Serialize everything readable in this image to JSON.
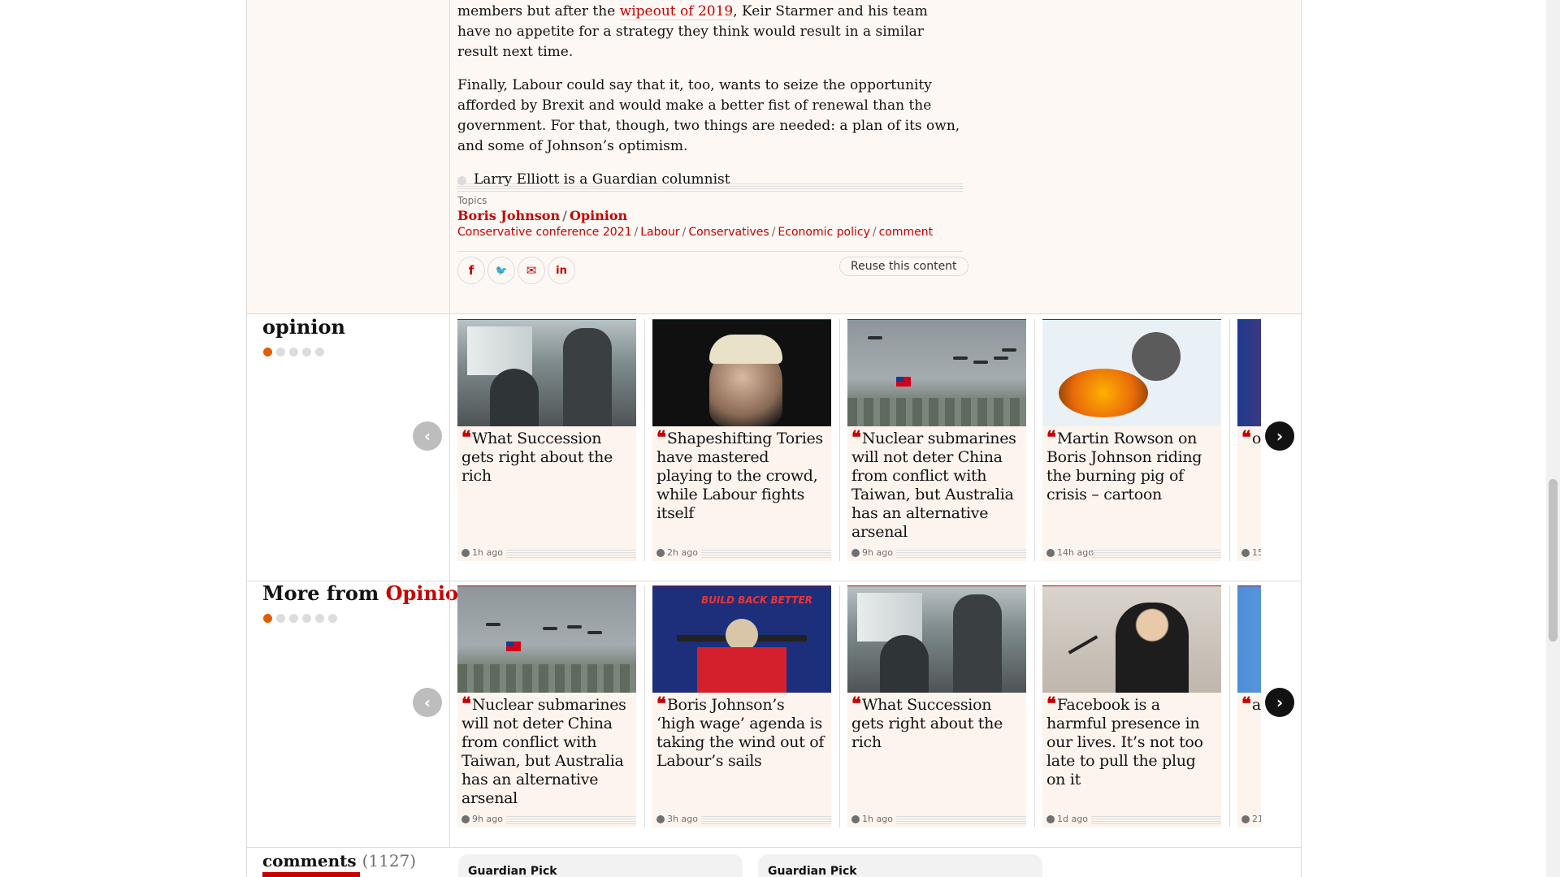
{
  "article": {
    "para1_before_link": "members but after the ",
    "para1_link": "wipeout of 2019",
    "para1_after_link": ", Keir Starmer and his team have no appetite for a strategy they think would result in a similar result next time.",
    "para2": "Finally, Labour could say that it, too, wants to seize the opportunity afforded by Brexit and would make a better fist of renewal than the government. For that, though, two things are needed: a plan of its own, and some of Johnson’s optimism.",
    "byline": "Larry Elliott is a Guardian columnist"
  },
  "topics": {
    "label": "Topics",
    "main": [
      "Boris Johnson",
      "Opinion"
    ],
    "sub": [
      "Conservative conference 2021",
      "Labour",
      "Conservatives",
      "Economic policy",
      "comment"
    ]
  },
  "share": {
    "facebook_glyph": "f",
    "twitter_glyph": "🐦",
    "email_glyph": "✉",
    "linkedin_glyph": "in",
    "reuse_label": "Reuse this content"
  },
  "opinion_section": {
    "title": "opinion",
    "cards": [
      {
        "headline": "What Succession gets right about the rich",
        "age": "1h ago",
        "image": "office-scene"
      },
      {
        "headline": "Shapeshifting Tories have mastered playing to the crowd, while Labour fights itself",
        "age": "2h ago",
        "image": "boris-johnson-portrait"
      },
      {
        "headline": "Nuclear submarines will not deter China from conflict with Taiwan, but Australia has an alternative arsenal",
        "age": "9h ago",
        "image": "taiwan-helicopters"
      },
      {
        "headline": "Martin Rowson on Boris Johnson riding the burning pig of crisis – cartoon",
        "age": "14h ago",
        "image": "cartoon"
      },
      {
        "headline": "on sp th",
        "age": "15",
        "image": "partial"
      }
    ],
    "prev_glyph": "‹",
    "next_glyph": "›"
  },
  "more_section": {
    "title_prefix": "More from ",
    "title_accent": "Opinion",
    "cards": [
      {
        "headline": "Nuclear submarines will not deter China from conflict with Taiwan, but Australia has an alternative arsenal",
        "age": "9h ago",
        "image": "taiwan-helicopters"
      },
      {
        "headline": "Boris Johnson’s ‘high wage’ agenda is taking the wind out of Labour’s sails",
        "age": "3h ago",
        "image": "build-back-better-speech"
      },
      {
        "headline": "What Succession gets right about the rich",
        "age": "1h ago",
        "image": "office-scene"
      },
      {
        "headline": "Facebook is a harmful presence in our lives. It’s not too late to pull the plug on it",
        "age": "1d ago",
        "image": "hearing-witness"
      },
      {
        "headline": "an isn ca ca",
        "age": "21",
        "image": "partial"
      }
    ],
    "bbb_text": "BUILD BACK BETTER",
    "prev_glyph": "‹",
    "next_glyph": "›"
  },
  "comments": {
    "title": "comments",
    "count": "(1127)",
    "picks": [
      "Guardian Pick",
      "Guardian Pick"
    ]
  },
  "colors": {
    "accent": "#c70000",
    "opinion_card_bg": "#fdf4ee",
    "page_bg": "#fdf8f4"
  }
}
